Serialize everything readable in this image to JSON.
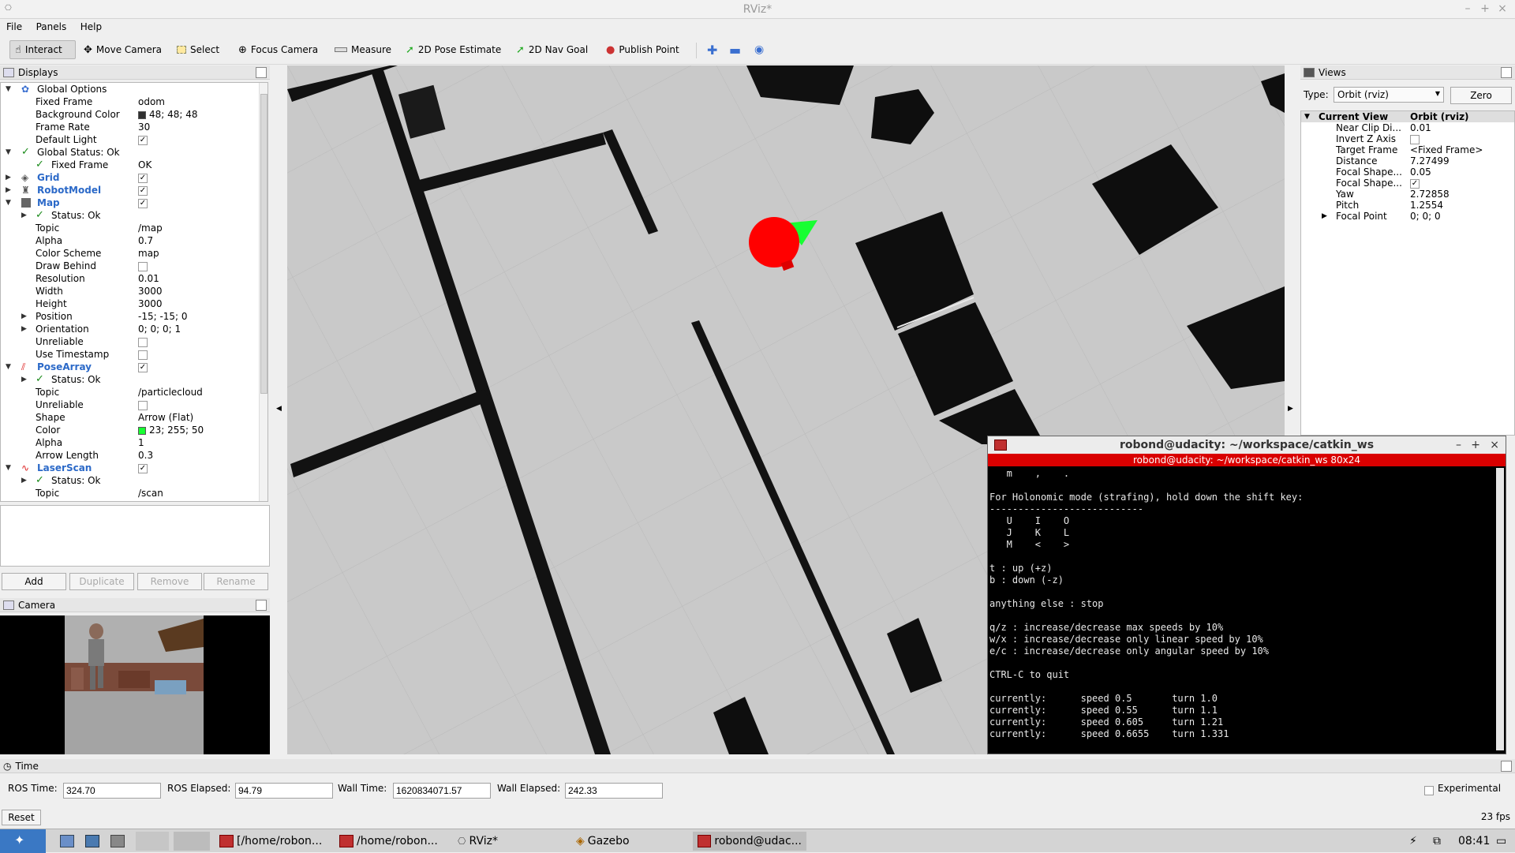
{
  "window": {
    "title": "RViz*"
  },
  "menu": [
    "File",
    "Panels",
    "Help"
  ],
  "toolbar": {
    "interact": "Interact",
    "move_camera": "Move Camera",
    "select": "Select",
    "focus_camera": "Focus Camera",
    "measure": "Measure",
    "pose_estimate": "2D Pose Estimate",
    "nav_goal": "2D Nav Goal",
    "publish_point": "Publish Point"
  },
  "displays": {
    "title": "Displays",
    "global_options": "Global Options",
    "fixed_frame_k": "Fixed Frame",
    "fixed_frame_v": "odom",
    "bg_color_k": "Background Color",
    "bg_color_v": "48; 48; 48",
    "frame_rate_k": "Frame Rate",
    "frame_rate_v": "30",
    "default_light_k": "Default Light",
    "global_status": "Global Status: Ok",
    "gs_fixed_frame_k": "Fixed Frame",
    "gs_fixed_frame_v": "OK",
    "grid": "Grid",
    "robot_model": "RobotModel",
    "map": "Map",
    "map_status": "Status: Ok",
    "topic_k": "Topic",
    "map_topic_v": "/map",
    "alpha_k": "Alpha",
    "map_alpha_v": "0.7",
    "color_scheme_k": "Color Scheme",
    "color_scheme_v": "map",
    "draw_behind_k": "Draw Behind",
    "resolution_k": "Resolution",
    "resolution_v": "0.01",
    "width_k": "Width",
    "width_v": "3000",
    "height_k": "Height",
    "height_v": "3000",
    "position_k": "Position",
    "position_v": "-15; -15; 0",
    "orientation_k": "Orientation",
    "orientation_v": "0; 0; 0; 1",
    "unreliable_k": "Unreliable",
    "use_timestamp_k": "Use Timestamp",
    "pose_array": "PoseArray",
    "pa_status": "Status: Ok",
    "pa_topic_v": "/particlecloud",
    "shape_k": "Shape",
    "shape_v": "Arrow (Flat)",
    "color_k": "Color",
    "color_v": "23; 255; 50",
    "pa_alpha_v": "1",
    "arrow_length_k": "Arrow Length",
    "arrow_length_v": "0.3",
    "laser_scan": "LaserScan",
    "ls_status": "Status: Ok",
    "ls_topic_v": "/scan"
  },
  "display_buttons": {
    "add": "Add",
    "duplicate": "Duplicate",
    "remove": "Remove",
    "rename": "Rename"
  },
  "camera": {
    "title": "Camera"
  },
  "views": {
    "title": "Views",
    "type_label": "Type:",
    "type_value": "Orbit (rviz)",
    "zero": "Zero",
    "current_view": "Current View",
    "current_view_v": "Orbit (rviz)",
    "near_clip_k": "Near Clip Di...",
    "near_clip_v": "0.01",
    "invert_z_k": "Invert Z Axis",
    "target_frame_k": "Target Frame",
    "target_frame_v": "<Fixed Frame>",
    "distance_k": "Distance",
    "distance_v": "7.27499",
    "focal_shape1_k": "Focal Shape...",
    "focal_shape1_v": "0.05",
    "focal_shape2_k": "Focal Shape...",
    "yaw_k": "Yaw",
    "yaw_v": "2.72858",
    "pitch_k": "Pitch",
    "pitch_v": "1.2554",
    "focal_point_k": "Focal Point",
    "focal_point_v": "0; 0; 0"
  },
  "terminal": {
    "title": "robond@udacity: ~/workspace/catkin_ws",
    "tab": "robond@udacity: ~/workspace/catkin_ws 80x24",
    "lines": [
      "   m    ,    .",
      "",
      "For Holonomic mode (strafing), hold down the shift key:",
      "---------------------------",
      "   U    I    O",
      "   J    K    L",
      "   M    <    >",
      "",
      "t : up (+z)",
      "b : down (-z)",
      "",
      "anything else : stop",
      "",
      "q/z : increase/decrease max speeds by 10%",
      "w/x : increase/decrease only linear speed by 10%",
      "e/c : increase/decrease only angular speed by 10%",
      "",
      "CTRL-C to quit",
      "",
      "currently:      speed 0.5       turn 1.0",
      "currently:      speed 0.55      turn 1.1",
      "currently:      speed 0.605     turn 1.21",
      "currently:      speed 0.6655    turn 1.331"
    ]
  },
  "time": {
    "title": "Time",
    "ros_time_label": "ROS Time:",
    "ros_time": "324.70",
    "ros_elapsed_label": "ROS Elapsed:",
    "ros_elapsed": "94.79",
    "wall_time_label": "Wall Time:",
    "wall_time": "1620834071.57",
    "wall_elapsed_label": "Wall Elapsed:",
    "wall_elapsed": "242.33",
    "experimental": "Experimental"
  },
  "status": {
    "reset": "Reset",
    "fps": "23 fps"
  },
  "taskbar": {
    "item1": "[/home/robon...",
    "item2": "/home/robon...",
    "item3": "RViz*",
    "item4": "Gazebo",
    "item5": "robond@udac...",
    "clock": "08:41"
  },
  "colors": {
    "bg": "#303030",
    "particle": "#17ff32",
    "robot": "#ff0000",
    "terminal_tab": "#d90000"
  }
}
